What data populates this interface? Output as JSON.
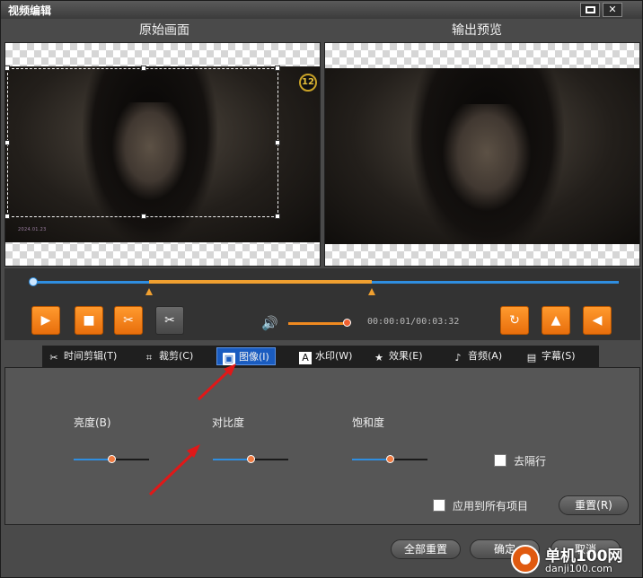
{
  "window": {
    "title": "视频编辑",
    "maximize_icon": "maximize-icon",
    "close_glyph": "✕"
  },
  "panels": {
    "original_label": "原始画面",
    "output_label": "输出预览",
    "rating_badge": "12",
    "source_caption": "2024.01.23"
  },
  "playback": {
    "current_time": "00:00:01/00:03:32",
    "volume_level": 0.9,
    "timeline_position": 0.0,
    "selection_start": 0.2,
    "selection_end": 0.58,
    "buttons": [
      "play-icon",
      "stop-icon",
      "scissors-icon",
      "cut-icon",
      "rotate-icon",
      "flip-vertical-icon",
      "flip-horizontal-icon"
    ]
  },
  "tabs": [
    {
      "label": "时间剪辑(T)",
      "icon": "scissors-icon"
    },
    {
      "label": "裁剪(C)",
      "icon": "crop-icon"
    },
    {
      "label": "图像(I)",
      "icon": "image-icon",
      "active": true
    },
    {
      "label": "水印(W)",
      "icon": "text-a-icon"
    },
    {
      "label": "效果(E)",
      "icon": "star-icon"
    },
    {
      "label": "音频(A)",
      "icon": "music-note-icon"
    },
    {
      "label": "字幕(S)",
      "icon": "subtitle-icon"
    }
  ],
  "image_settings": {
    "brightness_label": "亮度(B)",
    "brightness_value": 0.5,
    "contrast_label": "对比度",
    "contrast_value": 0.5,
    "saturation_label": "饱和度",
    "saturation_value": 0.5,
    "deinterlace_label": "去隔行",
    "deinterlace_checked": false,
    "apply_all_label": "应用到所有项目",
    "apply_all_checked": false,
    "reset_label": "重置(R)"
  },
  "footer": {
    "reset_all_label": "全部重置",
    "ok_label": "确定",
    "cancel_label": "取消"
  },
  "watermark": {
    "name": "单机100网",
    "url": "danji100.com"
  },
  "colors": {
    "accent_orange": "#f08a20",
    "accent_blue": "#2f8ee0",
    "tab_active": "#1a5cc0",
    "annotation_arrow": "#e01818"
  }
}
